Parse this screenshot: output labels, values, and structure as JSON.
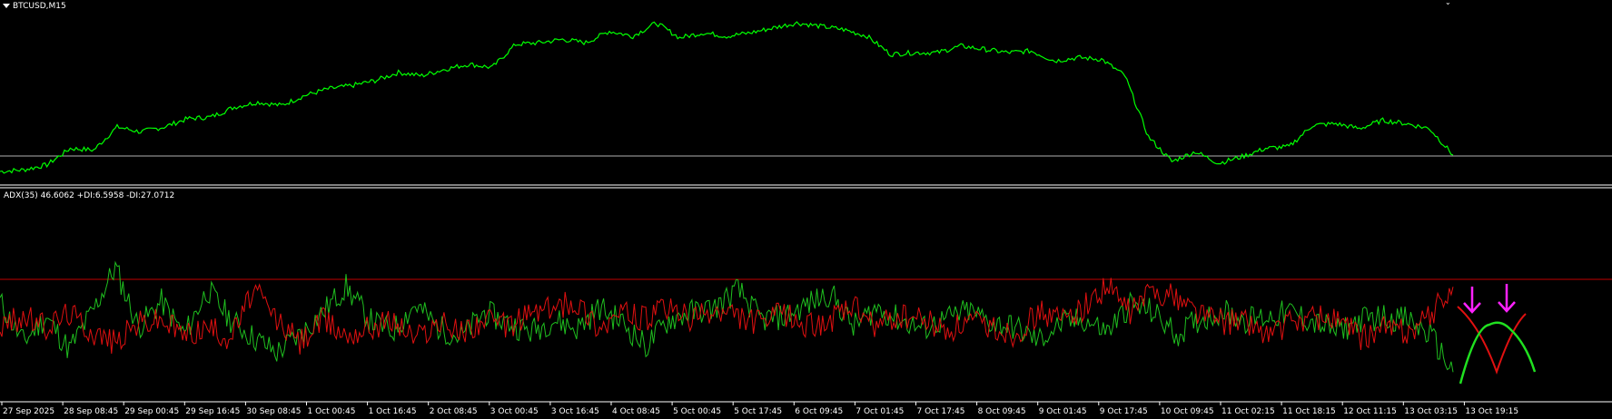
{
  "window": {
    "symbol_title": "BTCUSD,M15",
    "indicator_title": "ADX(35) 46.6062 +DI:6.5958 -DI:27.0712"
  },
  "colors": {
    "background": "#000000",
    "price_line": "#00ff00",
    "plus_di": "#1fbf1f",
    "minus_di": "#e01010",
    "level_line": "#c00000",
    "current_price_line": "#b0b0b0",
    "separator": "#ffffff",
    "annotation_arrow": "#ff22ff",
    "annotation_curve_red": "#e01010",
    "annotation_curve_green": "#20e020"
  },
  "icons": {
    "menu": "chevron-down-icon",
    "corner": "small-cross-icon"
  },
  "time_axis": {
    "labels": [
      "27 Sep 2025",
      "28 Sep 08:45",
      "29 Sep 00:45",
      "29 Sep 16:45",
      "30 Sep 08:45",
      "1 Oct 00:45",
      "1 Oct 16:45",
      "2 Oct 08:45",
      "3 Oct 00:45",
      "3 Oct 16:45",
      "4 Oct 08:45",
      "5 Oct 00:45",
      "5 Oct 17:45",
      "6 Oct 09:45",
      "7 Oct 01:45",
      "7 Oct 17:45",
      "8 Oct 09:45",
      "9 Oct 01:45",
      "9 Oct 17:45",
      "10 Oct 09:45",
      "11 Oct 02:15",
      "11 Oct 18:15",
      "12 Oct 11:15",
      "13 Oct 03:15",
      "13 Oct 19:15"
    ]
  },
  "chart_data": [
    {
      "type": "line",
      "title": "BTCUSD,M15",
      "series": [
        {
          "name": "BTCUSD,M15",
          "values": [
            0.06,
            0.07,
            0.1,
            0.2,
            0.19,
            0.33,
            0.3,
            0.33,
            0.38,
            0.39,
            0.45,
            0.48,
            0.46,
            0.52,
            0.56,
            0.58,
            0.61,
            0.66,
            0.64,
            0.68,
            0.71,
            0.69,
            0.83,
            0.84,
            0.86,
            0.84,
            0.91,
            0.88,
            0.96,
            0.87,
            0.9,
            0.88,
            0.9,
            0.93,
            0.96,
            0.94,
            0.92,
            0.88,
            0.77,
            0.78,
            0.78,
            0.82,
            0.8,
            0.78,
            0.79,
            0.73,
            0.75,
            0.74,
            0.64,
            0.27,
            0.12,
            0.18,
            0.11,
            0.15,
            0.2,
            0.21,
            0.34,
            0.35,
            0.32,
            0.37,
            0.35,
            0.32,
            0.16
          ]
        }
      ]
    },
    {
      "type": "line",
      "title": "ADX(35) 46.6062 +DI:6.5958 -DI:27.0712",
      "ylim": [
        0,
        1
      ],
      "levels": [
        0.77
      ],
      "series": [
        {
          "name": "+DI",
          "values": [
            0.62,
            0.35,
            0.52,
            0.3,
            0.55,
            0.85,
            0.45,
            0.62,
            0.4,
            0.7,
            0.5,
            0.38,
            0.28,
            0.4,
            0.55,
            0.72,
            0.5,
            0.42,
            0.6,
            0.45,
            0.38,
            0.55,
            0.48,
            0.42,
            0.5,
            0.44,
            0.58,
            0.48,
            0.32,
            0.5,
            0.55,
            0.58,
            0.7,
            0.5,
            0.52,
            0.6,
            0.68,
            0.45,
            0.58,
            0.5,
            0.44,
            0.5,
            0.56,
            0.48,
            0.45,
            0.36,
            0.47,
            0.5,
            0.42,
            0.6,
            0.55,
            0.4,
            0.5,
            0.56,
            0.5,
            0.52,
            0.55,
            0.48,
            0.42,
            0.5,
            0.52,
            0.5,
            0.4,
            0.15
          ]
        },
        {
          "name": "-DI",
          "values": [
            0.45,
            0.52,
            0.45,
            0.55,
            0.42,
            0.35,
            0.48,
            0.5,
            0.4,
            0.45,
            0.38,
            0.7,
            0.5,
            0.35,
            0.5,
            0.4,
            0.45,
            0.5,
            0.38,
            0.48,
            0.42,
            0.5,
            0.45,
            0.55,
            0.58,
            0.62,
            0.45,
            0.55,
            0.5,
            0.58,
            0.5,
            0.55,
            0.52,
            0.48,
            0.55,
            0.45,
            0.5,
            0.58,
            0.45,
            0.52,
            0.5,
            0.42,
            0.48,
            0.45,
            0.4,
            0.55,
            0.5,
            0.58,
            0.72,
            0.55,
            0.7,
            0.65,
            0.55,
            0.48,
            0.5,
            0.4,
            0.48,
            0.52,
            0.5,
            0.38,
            0.45,
            0.42,
            0.52,
            0.72
          ]
        }
      ]
    }
  ]
}
